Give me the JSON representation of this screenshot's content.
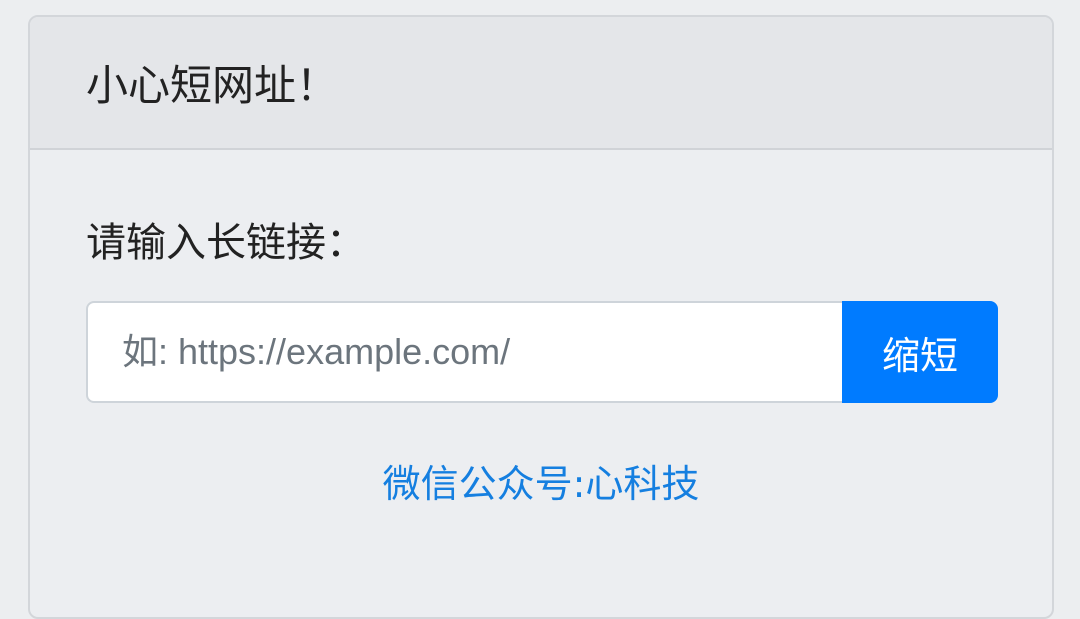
{
  "header": {
    "title": "小心短网址！"
  },
  "form": {
    "label": "请输入长链接：",
    "placeholder": "如: https://example.com/",
    "value": "",
    "submit_label": "缩短"
  },
  "footer": {
    "link_text": "微信公众号:心科技"
  },
  "colors": {
    "accent": "#007bff"
  }
}
